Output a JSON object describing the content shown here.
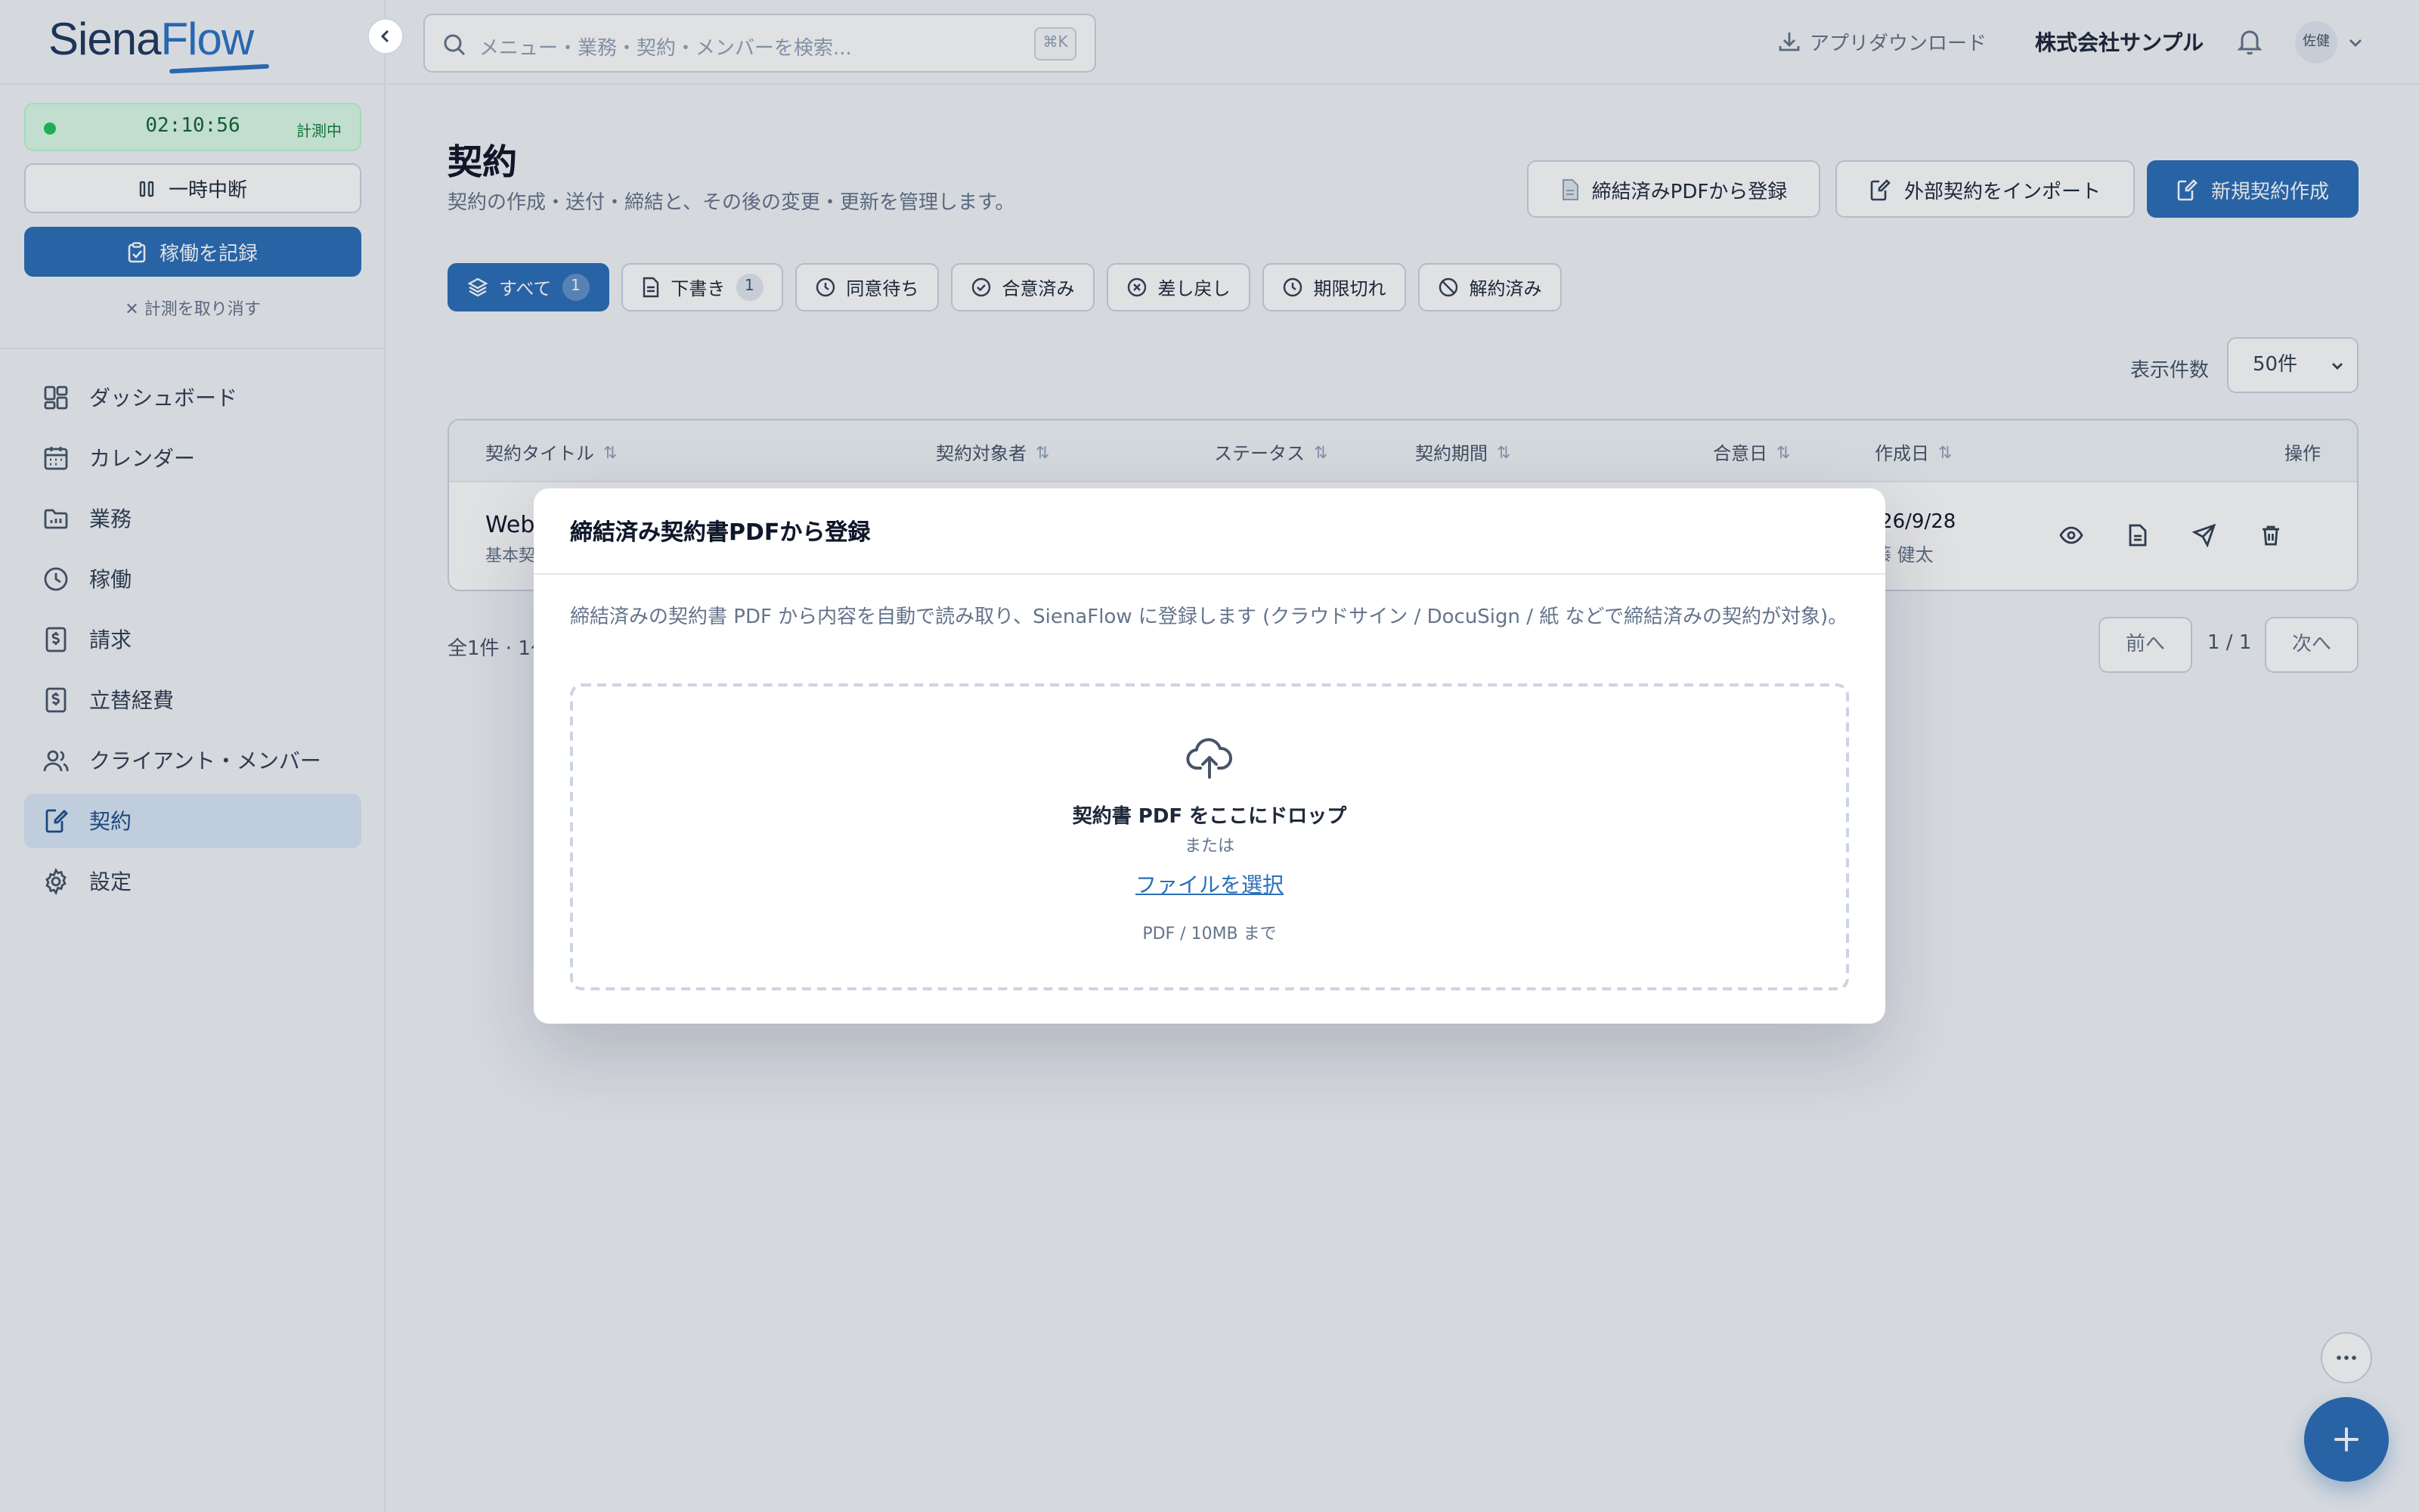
{
  "app": {
    "logo_part1": "Siena",
    "logo_part2": "Flow"
  },
  "timer": {
    "time": "02:10:56",
    "status": "計測中"
  },
  "sidebar": {
    "pause_label": "一時中断",
    "record_label": "稼働を記録",
    "cancel_label": "計測を取り消す",
    "items": [
      {
        "label": "ダッシュボード",
        "icon": "dashboard-icon"
      },
      {
        "label": "カレンダー",
        "icon": "calendar-icon"
      },
      {
        "label": "業務",
        "icon": "folder-icon"
      },
      {
        "label": "稼働",
        "icon": "clock-icon"
      },
      {
        "label": "請求",
        "icon": "invoice-icon"
      },
      {
        "label": "立替経費",
        "icon": "expense-icon"
      },
      {
        "label": "クライアント・メンバー",
        "icon": "users-icon"
      },
      {
        "label": "契約",
        "icon": "contract-icon",
        "active": true
      },
      {
        "label": "設定",
        "icon": "settings-icon"
      }
    ]
  },
  "topbar": {
    "search_placeholder": "メニュー・業務・契約・メンバーを検索...",
    "search_shortcut": "⌘K",
    "download_label": "アプリダウンロード",
    "company": "株式会社サンプル",
    "avatar": "佐健"
  },
  "page": {
    "title": "契約",
    "subtitle": "契約の作成・送付・締結と、その後の変更・更新を管理します。",
    "btn_pdf": "締結済みPDFから登録",
    "btn_import": "外部契約をインポート",
    "btn_new": "新規契約作成"
  },
  "tabs": [
    {
      "label": "すべて",
      "count": "1",
      "active": true
    },
    {
      "label": "下書き",
      "count": "1"
    },
    {
      "label": "同意待ち"
    },
    {
      "label": "合意済み"
    },
    {
      "label": "差し戻し"
    },
    {
      "label": "期限切れ"
    },
    {
      "label": "解約済み"
    }
  ],
  "perpage": {
    "label": "表示件数",
    "value": "50件"
  },
  "table": {
    "headers": [
      "契約タイトル",
      "契約対象者",
      "ステータス",
      "契約期間",
      "合意日",
      "作成日",
      "操作"
    ],
    "row": {
      "title": "Web",
      "subtitle": "基本契",
      "created": "2026/9/28",
      "creator": "佐藤 健太"
    }
  },
  "pagination": {
    "total": "全1件 · 1〜",
    "prev": "前へ",
    "info": "1 / 1",
    "next": "次へ"
  },
  "modal": {
    "title": "締結済み契約書PDFから登録",
    "description": "締結済みの契約書 PDF から内容を自動で読み取り、SienaFlow に登録します (クラウドサイン / DocuSign / 紙 などで締結済みの契約が対象)。",
    "drop_title": "契約書 PDF をここにドロップ",
    "drop_or": "または",
    "choose_file": "ファイルを選択",
    "limit": "PDF / 10MB まで"
  },
  "colors": {
    "primary": "#2c6fb8",
    "success": "#22c55e"
  }
}
